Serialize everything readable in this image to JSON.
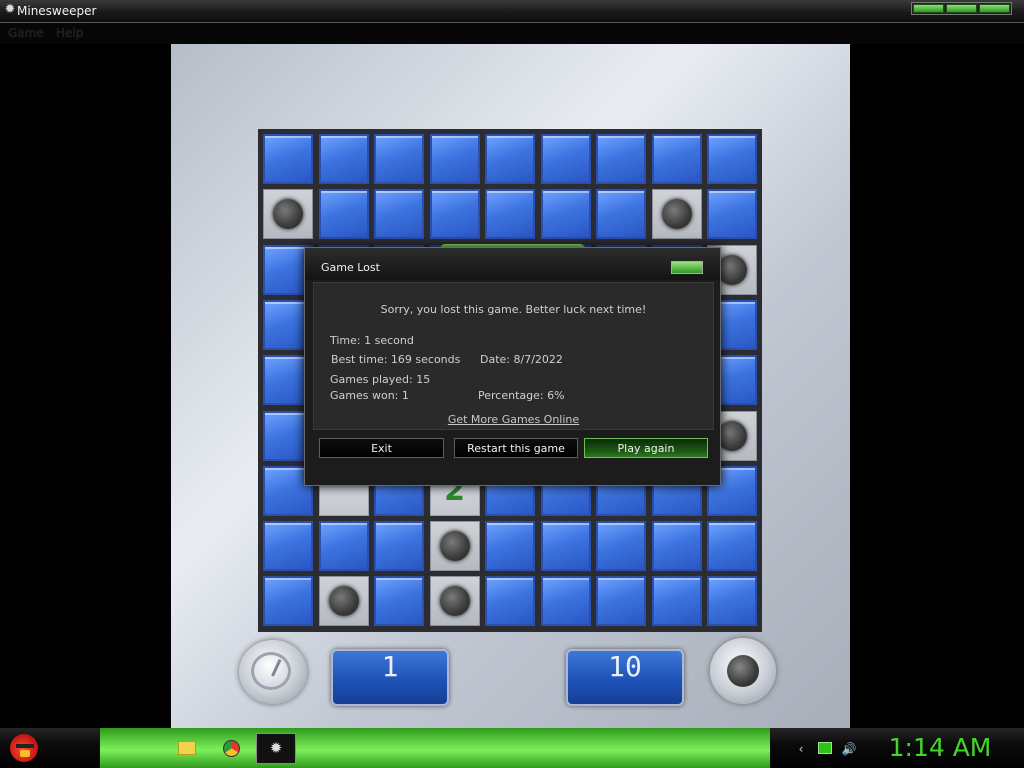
{
  "window": {
    "title": "Minesweeper",
    "menu": [
      "Game",
      "Help"
    ]
  },
  "board": {
    "rows": [
      [
        "c",
        "c",
        "c",
        "c",
        "c",
        "c",
        "c",
        "c",
        "c"
      ],
      [
        "m",
        "c",
        "c",
        "c",
        "c",
        "c",
        "c",
        "m",
        "c"
      ],
      [
        "c",
        "c",
        "c",
        "c",
        "c",
        "c",
        "c",
        "c",
        "m"
      ],
      [
        "c",
        "c",
        "c",
        "c",
        "c",
        "c",
        "c",
        "c",
        "c"
      ],
      [
        "c",
        "c",
        "c",
        "c",
        "c",
        "c",
        "c",
        "c",
        "c"
      ],
      [
        "c",
        "c",
        "c",
        "c",
        "c",
        "c",
        "c",
        "c",
        "m"
      ],
      [
        "c",
        "r",
        "c",
        "2",
        "c",
        "c",
        "c",
        "c",
        "c"
      ],
      [
        "c",
        "c",
        "c",
        "m",
        "c",
        "c",
        "c",
        "c",
        "c"
      ],
      [
        "c",
        "m",
        "c",
        "m",
        "c",
        "c",
        "c",
        "c",
        "c"
      ]
    ],
    "timer_value": "1",
    "mines_value": "10"
  },
  "dialog": {
    "title": "Game Lost",
    "message": "Sorry, you lost this game. Better luck next time!",
    "time": "Time: 1 second",
    "best_time": "Best time: 169 seconds",
    "date": "Date: 8/7/2022",
    "games_played": "Games played: 15",
    "games_won": "Games won: 1",
    "percentage": "Percentage: 6%",
    "link": "Get More Games Online",
    "buttons": {
      "exit": "Exit",
      "restart": "Restart this game",
      "play_again": "Play again"
    }
  },
  "taskbar": {
    "clock": "1:14 AM",
    "pinned": [
      "folder-icon",
      "chrome-icon",
      "minesweeper-icon"
    ],
    "tray": [
      "arrow-icon",
      "network-icon",
      "volume-icon"
    ]
  },
  "colors": {
    "accent_green": "#43d62a",
    "tile_blue": "#3d74e0"
  }
}
